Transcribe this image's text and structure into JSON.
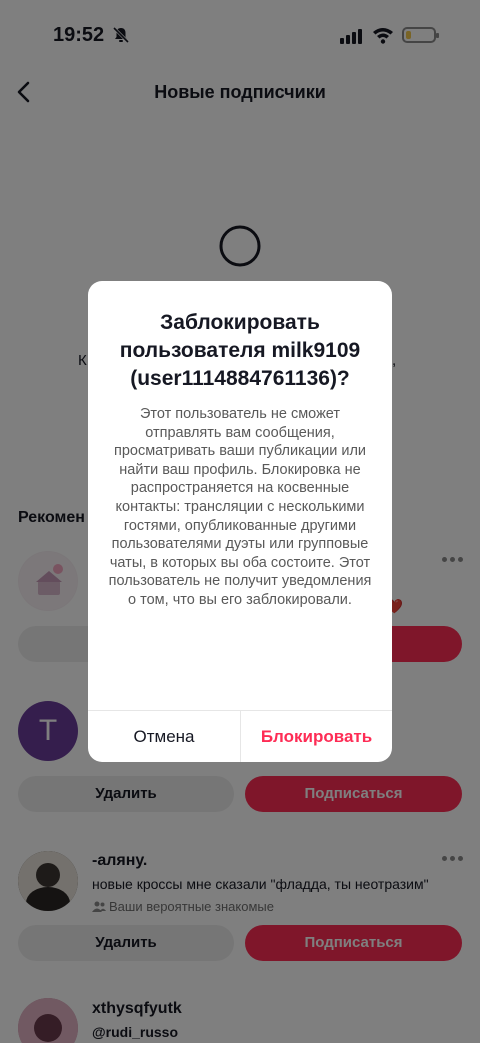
{
  "status_bar": {
    "time": "19:52"
  },
  "header": {
    "title": "Новые подписчики"
  },
  "empty_state": {
    "partial_left": "К",
    "partial_right": ","
  },
  "recommendations": {
    "section_title": "Рекомен",
    "items": [
      {
        "partial_text": "я ❤️",
        "remove_label": "",
        "follow_label": "дписаться"
      },
      {
        "avatar_letter": "T",
        "remove_label": "Удалить",
        "follow_label": "Подписаться"
      },
      {
        "username": "-аляну.",
        "subtitle": "новые кроссы мне сказали \"фладда, ты неотразим\"",
        "hint": "Ваши вероятные знакомые",
        "remove_label": "Удалить",
        "follow_label": "Подписаться"
      },
      {
        "username": "xthysqfyutk",
        "subtitle": "@rudi_russo"
      }
    ]
  },
  "dialog": {
    "title": "Заблокировать пользователя milk9109 (user1114884761136)?",
    "body": "Этот пользователь не сможет отправлять вам сообщения, просматривать ваши публикации или найти ваш профиль. Блокировка не распространяется на косвенные контакты: трансляции с несколькими гостями, опубликованные другими пользователями дуэты или групповые чаты, в которых вы оба состоите. Этот пользователь не получит уведомления о том, что вы его заблокировали.",
    "cancel_label": "Отмена",
    "confirm_label": "Блокировать"
  },
  "colors": {
    "accent": "#fe2c55",
    "overlay": "rgba(0,0,0,0.5)"
  }
}
